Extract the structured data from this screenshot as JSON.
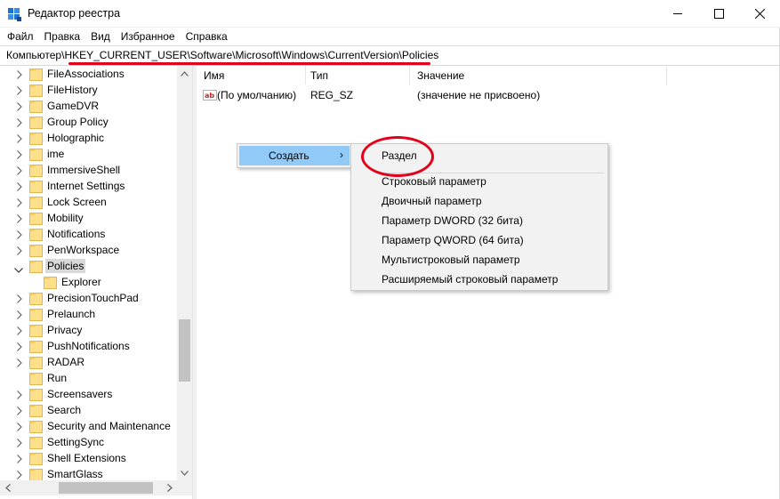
{
  "window": {
    "title": "Редактор реестра",
    "accent_red": "#e3001b",
    "menu_highlight": "#91c9f7"
  },
  "menu": [
    "Файл",
    "Правка",
    "Вид",
    "Избранное",
    "Справка"
  ],
  "address": {
    "path": "Компьютер\\HKEY_CURRENT_USER\\Software\\Microsoft\\Windows\\CurrentVersion\\Policies"
  },
  "tree": {
    "items": [
      {
        "label": "FileAssociations",
        "expand": "collapsed"
      },
      {
        "label": "FileHistory",
        "expand": "collapsed"
      },
      {
        "label": "GameDVR",
        "expand": "collapsed"
      },
      {
        "label": "Group Policy",
        "expand": "collapsed"
      },
      {
        "label": "Holographic",
        "expand": "collapsed"
      },
      {
        "label": "ime",
        "expand": "collapsed"
      },
      {
        "label": "ImmersiveShell",
        "expand": "collapsed"
      },
      {
        "label": "Internet Settings",
        "expand": "collapsed"
      },
      {
        "label": "Lock Screen",
        "expand": "collapsed"
      },
      {
        "label": "Mobility",
        "expand": "collapsed"
      },
      {
        "label": "Notifications",
        "expand": "collapsed"
      },
      {
        "label": "PenWorkspace",
        "expand": "collapsed"
      },
      {
        "label": "Policies",
        "expand": "expanded",
        "selected": true
      },
      {
        "label": "Explorer",
        "expand": "none",
        "child": true
      },
      {
        "label": "PrecisionTouchPad",
        "expand": "collapsed"
      },
      {
        "label": "Prelaunch",
        "expand": "collapsed"
      },
      {
        "label": "Privacy",
        "expand": "collapsed"
      },
      {
        "label": "PushNotifications",
        "expand": "collapsed"
      },
      {
        "label": "RADAR",
        "expand": "collapsed"
      },
      {
        "label": "Run",
        "expand": "none"
      },
      {
        "label": "Screensavers",
        "expand": "collapsed"
      },
      {
        "label": "Search",
        "expand": "collapsed"
      },
      {
        "label": "Security and Maintenance",
        "expand": "collapsed"
      },
      {
        "label": "SettingSync",
        "expand": "collapsed"
      },
      {
        "label": "Shell Extensions",
        "expand": "collapsed"
      },
      {
        "label": "SmartGlass",
        "expand": "collapsed"
      }
    ]
  },
  "values": {
    "headers": {
      "name": "Имя",
      "type": "Тип",
      "data": "Значение"
    },
    "rows": [
      {
        "name": "(По умолчанию)",
        "type": "REG_SZ",
        "data": "(значение не присвоено)"
      }
    ]
  },
  "context_menu": {
    "create_label": "Создать",
    "create_arrow": "›"
  },
  "submenu": {
    "key": "Раздел",
    "items": [
      "Строковый параметр",
      "Двоичный параметр",
      "Параметр DWORD (32 бита)",
      "Параметр QWORD (64 бита)",
      "Мультистроковый параметр",
      "Расширяемый строковый параметр"
    ]
  }
}
